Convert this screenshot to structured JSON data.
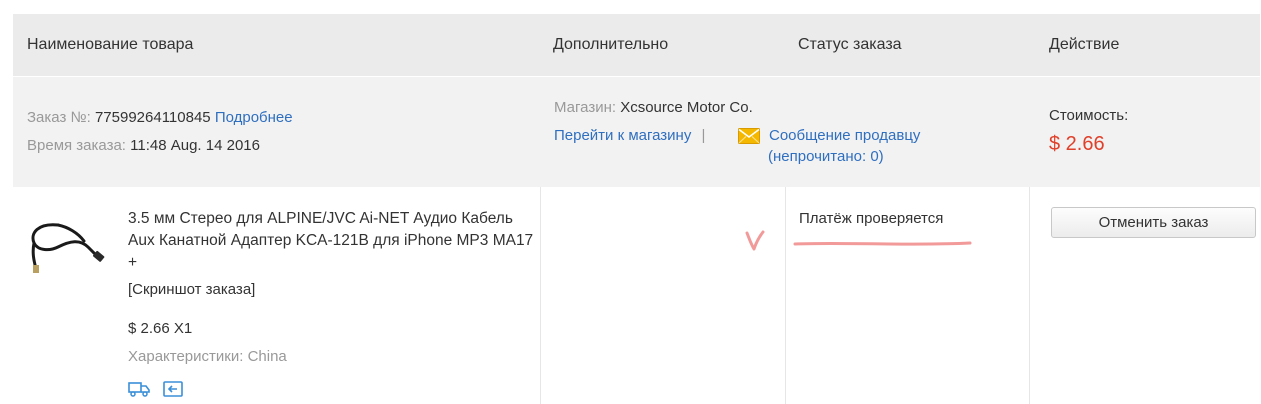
{
  "header": {
    "col_product": "Наименование товара",
    "col_extra": "Дополнительно",
    "col_status": "Статус заказа",
    "col_action": "Действие"
  },
  "order": {
    "number_label": "Заказ №:",
    "number_value": "77599264110845",
    "details_link": "Подробнее",
    "time_label": "Время заказа:",
    "time_value": "11:48 Aug. 14 2016"
  },
  "store": {
    "label": "Магазин:",
    "name": "Xcsource Motor Co.",
    "goto_link": "Перейти к магазину",
    "separator": "|",
    "message_link": "Сообщение продавцу",
    "unread_open": "(непрочитано: ",
    "unread_count": "0",
    "unread_close": ")"
  },
  "cost": {
    "label": "Стоимость:",
    "value": "$ 2.66"
  },
  "product": {
    "title": "3.5 мм Стерео для ALPINE/JVC Ai-NET Аудио Кабель Aux Канатной Адаптер KCA-121B для iPhone MP3 MA17 +",
    "screenshot_link": "[Скриншот заказа]",
    "price_qty": "$ 2.66 X1",
    "specs_label": "Характеристики:",
    "specs_value": "China"
  },
  "status": {
    "text": "Платёж проверяется"
  },
  "actions": {
    "cancel_label": "Отменить заказ"
  },
  "annotations": {
    "check_mark": "v"
  },
  "colors": {
    "link": "#2f6fc0",
    "price": "#e0402a",
    "header_bg": "#ebebeb",
    "summary_bg": "#f2f2f2",
    "annotation": "#f29a9a"
  }
}
